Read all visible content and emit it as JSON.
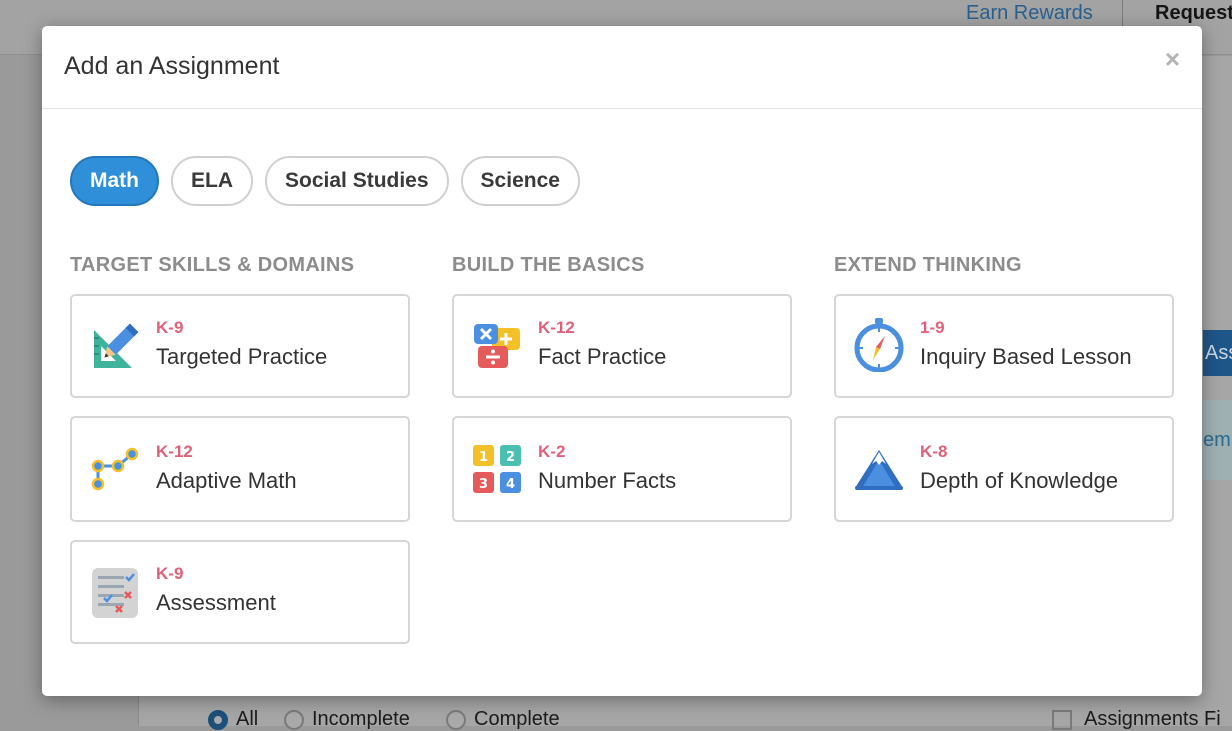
{
  "background": {
    "earn_rewards": "Earn Rewards",
    "request": "Request",
    "side_button": "Ass",
    "side_box": "emi",
    "filters": [
      "All",
      "Incomplete",
      "Complete"
    ],
    "assignments_filter": "Assignments Fi"
  },
  "modal": {
    "title": "Add an Assignment",
    "close": "×"
  },
  "tabs": [
    "Math",
    "ELA",
    "Social Studies",
    "Science"
  ],
  "active_tab": "Math",
  "columns": [
    {
      "heading": "TARGET SKILLS & DOMAINS",
      "cards": [
        {
          "grade": "K-9",
          "name": "Targeted Practice",
          "icon": "ruler-pencil-icon"
        },
        {
          "grade": "K-12",
          "name": "Adaptive Math",
          "icon": "path-nodes-icon"
        },
        {
          "grade": "K-9",
          "name": "Assessment",
          "icon": "checklist-icon"
        }
      ]
    },
    {
      "heading": "BUILD THE BASICS",
      "cards": [
        {
          "grade": "K-12",
          "name": "Fact Practice",
          "icon": "operations-icon"
        },
        {
          "grade": "K-2",
          "name": "Number Facts",
          "icon": "number-blocks-icon"
        }
      ]
    },
    {
      "heading": "EXTEND THINKING",
      "cards": [
        {
          "grade": "1-9",
          "name": "Inquiry Based Lesson",
          "icon": "compass-icon"
        },
        {
          "grade": "K-8",
          "name": "Depth of Knowledge",
          "icon": "mountain-icon"
        }
      ]
    }
  ],
  "colors": {
    "accent": "#2f8fd8",
    "grade": "#e0607a"
  }
}
